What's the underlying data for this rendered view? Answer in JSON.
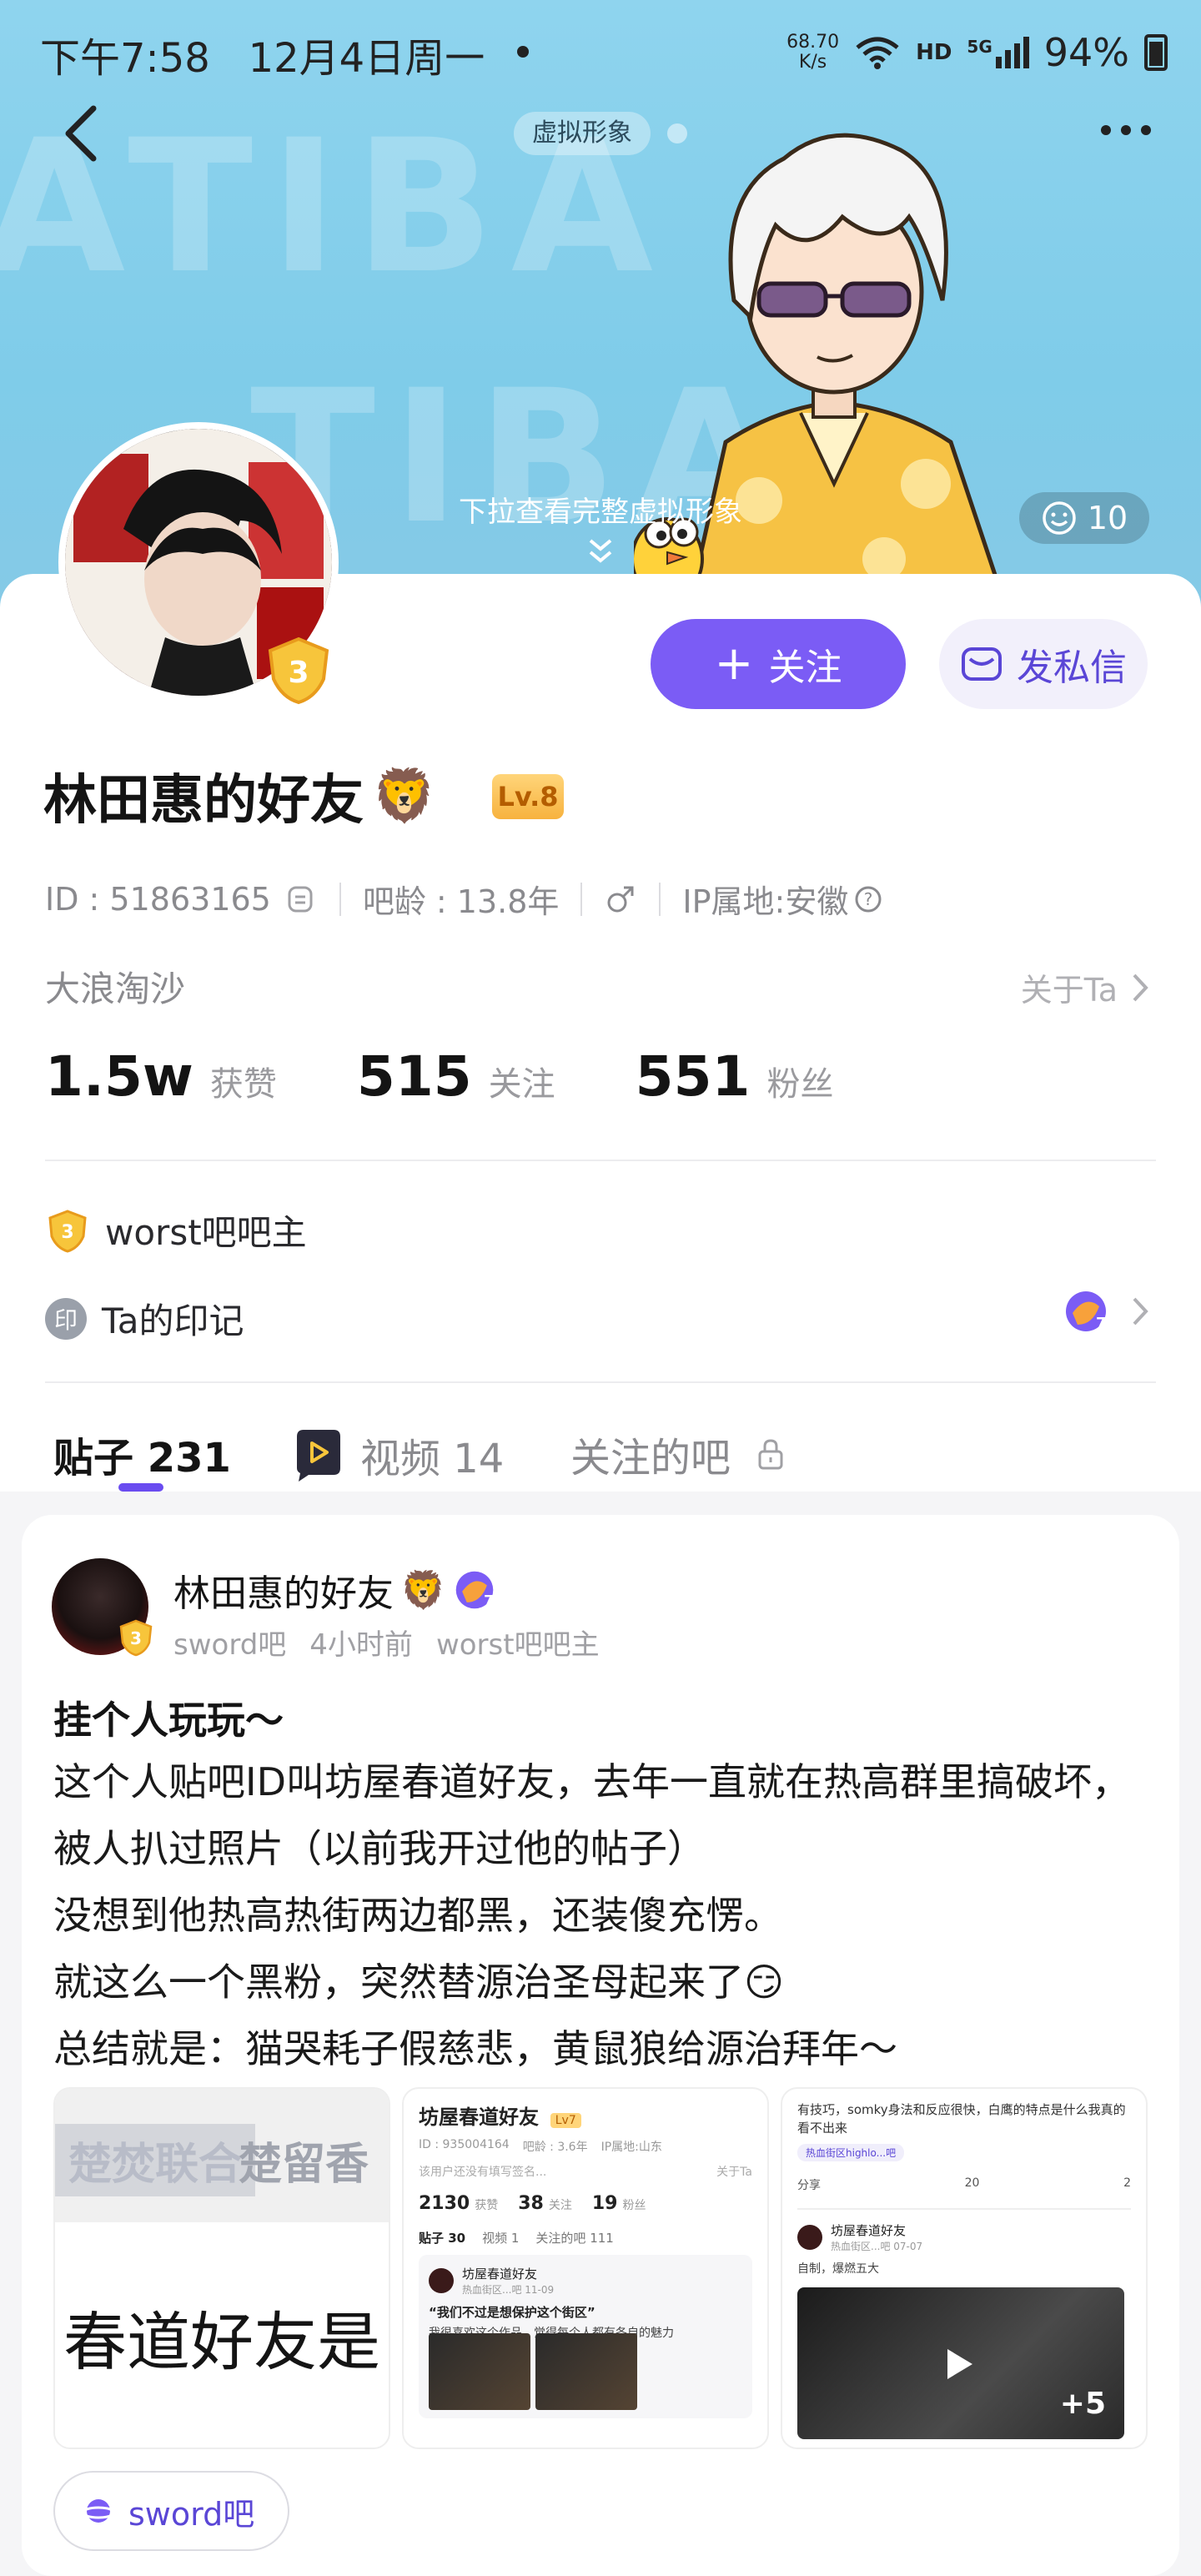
{
  "status": {
    "time": "下午7:58",
    "date": "12月4日周一",
    "net_speed_value": "68.70",
    "net_speed_unit": "K/s",
    "hd": "HD",
    "signal": "5G",
    "battery": "94%"
  },
  "banner": {
    "chip_label": "虚拟形象",
    "pull_hint": "下拉查看完整虚拟形象",
    "like_count": "10"
  },
  "actions": {
    "follow_label": "关注",
    "message_label": "发私信"
  },
  "profile": {
    "name": "林田惠的好友",
    "level": "Lv.8",
    "id_label": "ID : 51863165",
    "age_label": "吧龄 : 13.8年",
    "ip_label": "IP属地:安徽",
    "bio": "大浪淘沙",
    "about_link": "关于Ta",
    "badge_text": "worst吧吧主",
    "imprint_seal": "印",
    "imprint_label": "Ta的印记",
    "accent_color": "#7b5cf5"
  },
  "stats": [
    {
      "value": "1.5w",
      "label": "获赞"
    },
    {
      "value": "515",
      "label": "关注"
    },
    {
      "value": "551",
      "label": "粉丝"
    }
  ],
  "tabs": {
    "posts": "贴子 231",
    "videos": "视频 14",
    "followed": "关注的吧"
  },
  "post": {
    "author": "林田惠的好友",
    "forum": "sword吧",
    "time": "4小时前",
    "role": "worst吧吧主",
    "title": "挂个人玩玩～",
    "lines": [
      "这个人贴吧ID叫坊屋春道好友，去年一直就在热高群里搞破坏，被人扒过照片（以前我开过他的帖子）",
      "没想到他热高热街两边都黑，还装傻充愣。",
      "就这么一个黑粉，突然替源治圣母起来了😏",
      "总结就是：猫哭耗子假慈悲，黄鼠狼给源治拜年～"
    ],
    "forum_tag": "sword吧",
    "images": {
      "img1_left": "楚焚联合",
      "img1_right": "楚留香",
      "img1_big": "春道好友是",
      "img2_name": "坊屋春道好友",
      "img2_level": "Lv7",
      "img2_id": "ID : 935004164",
      "img2_age": "吧龄 : 3.6年",
      "img2_ip": "IP属地:山东",
      "img2_bio": "该用户还没有填写签名...",
      "img2_about": "关于Ta",
      "img2_stats": [
        {
          "value": "2130",
          "label": "获赞"
        },
        {
          "value": "38",
          "label": "关注"
        },
        {
          "value": "19",
          "label": "粉丝"
        }
      ],
      "img2_tab1": "贴子 30",
      "img2_tab2": "视频 1",
      "img2_tab3": "关注的吧 111",
      "img2_post_author": "坊屋春道好友",
      "img2_post_meta": "热血街区...吧 11-09",
      "img2_quote": "“我们不过是想保护这个街区”",
      "img2_text": "我很喜欢这个作品，觉得每个人都有各自的魅力",
      "img3_text": "有技巧，somky身法和反应很快，白鹰的特点是什么我真的看不出来",
      "img3_tag": "热血街区highlo...吧",
      "img3_share": "分享",
      "img3_comments": "20",
      "img3_likes": "2",
      "img3_author": "坊屋春道好友",
      "img3_meta": "热血街区...吧 07-07",
      "img3_caption": "自制，爆燃五大",
      "img3_more": "+5"
    }
  }
}
